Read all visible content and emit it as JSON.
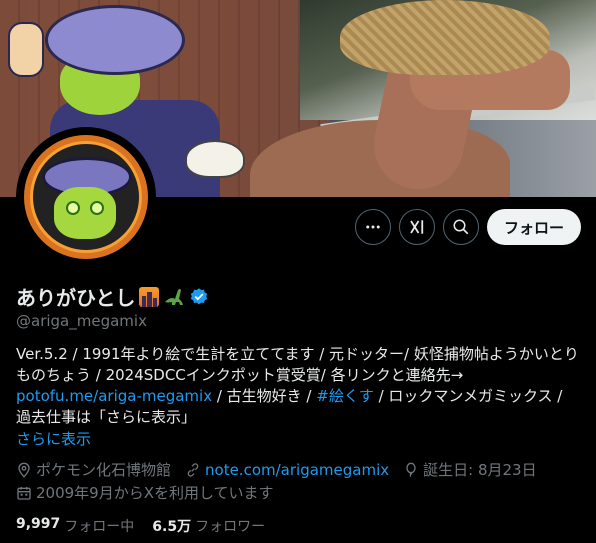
{
  "profile": {
    "display_name": "ありがひとし",
    "handle": "@ariga_megamix",
    "verified": true,
    "emoji": [
      "sunset-cityscape-emoji",
      "sauropod-emoji"
    ]
  },
  "actions": {
    "more_icon": "more-icon",
    "grok_icon": "grok-icon",
    "search_icon": "search-icon",
    "follow_label": "フォロー"
  },
  "bio": {
    "part1": "Ver.5.2 / 1991年より絵で生計を立ててます / 元ドッター/ 妖怪捕物帖ようかいとりものちょう / 2024SDCCインクポット賞受賞/ 各リンクと連絡先→ ",
    "link1": "potofu.me/ariga-megamix",
    "part2": " / 古生物好き / ",
    "hashtag": "#絵くす",
    "part3": " / ロックマンメガミックス / 過去仕事は「さらに表示」",
    "show_more": "さらに表示"
  },
  "meta": {
    "location": "ポケモン化石博物館",
    "website": "note.com/arigamegamix",
    "birthday": "誕生日: 8月23日",
    "joined": "2009年9月からXを利用しています"
  },
  "stats": {
    "following_count": "9,997",
    "following_label": "フォロー中",
    "followers_count": "6.5万",
    "followers_label": "フォロワー"
  },
  "colors": {
    "background": "#000000",
    "text": "#e7e9ea",
    "muted": "#71767b",
    "link": "#1d9bf0",
    "follow_button_bg": "#eff3f4",
    "verified": "#1d9bf0"
  }
}
